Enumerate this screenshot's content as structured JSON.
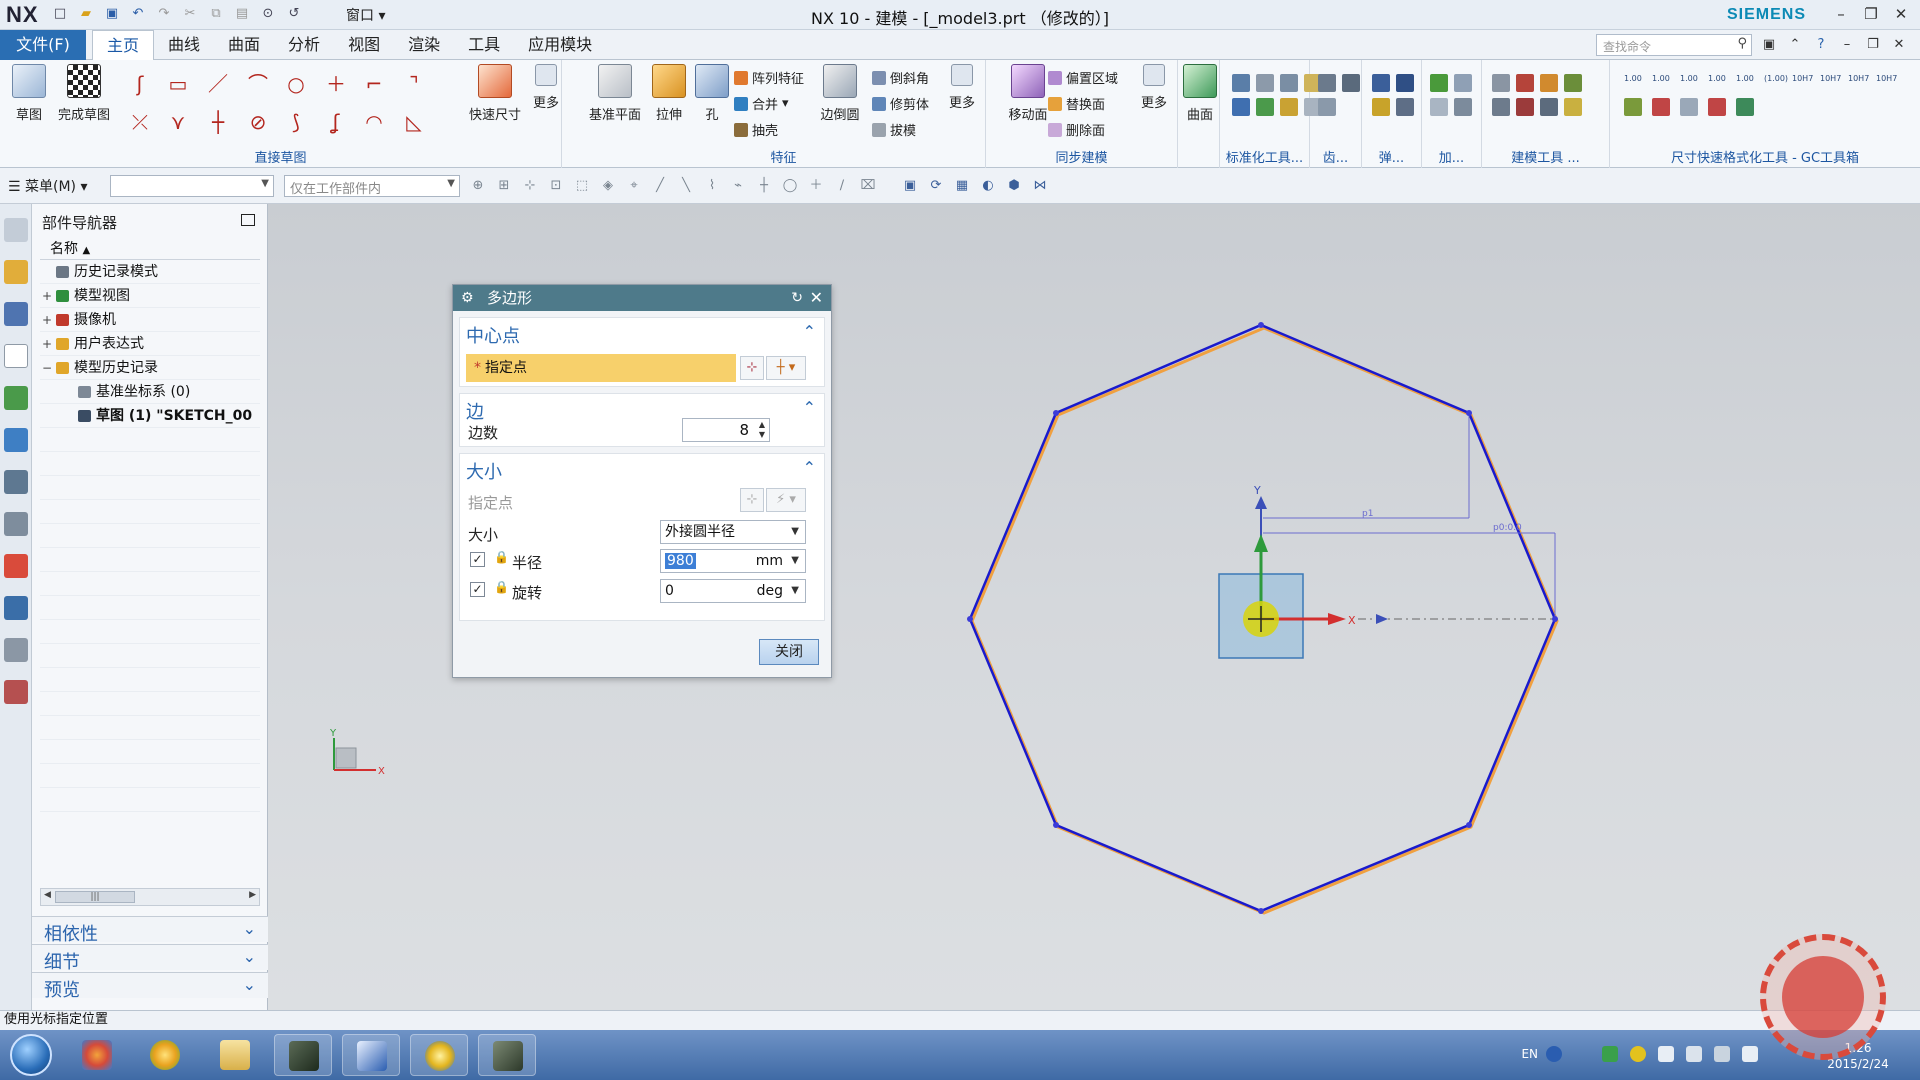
{
  "app": {
    "logo": "NX",
    "title": "NX 10 - 建模 - [_model3.prt （修改的）]",
    "brand": "SIEMENS",
    "window_menu": "窗口"
  },
  "ribbon_tabs": {
    "file": "文件(F)",
    "tabs": [
      "主页",
      "曲线",
      "曲面",
      "分析",
      "视图",
      "渲染",
      "工具",
      "应用模块"
    ],
    "search_placeholder": "查找命令"
  },
  "ribbon": {
    "sketch": "草图",
    "finish_sketch": "完成草图",
    "group_direct_sketch": "直接草图",
    "quick_dimension": "快速尺寸",
    "more": "更多",
    "datum_plane": "基准平面",
    "extrude": "拉伸",
    "hole": "孔",
    "pattern_feature": "阵列特征",
    "unite": "合并",
    "shell": "抽壳",
    "edge_blend": "边倒圆",
    "chamfer": "倒斜角",
    "trim_body": "修剪体",
    "draft": "拔模",
    "group_feature": "特征",
    "move_face": "移动面",
    "offset_region": "偏置区域",
    "replace_face": "替换面",
    "delete_face": "删除面",
    "group_sync": "同步建模",
    "surface": "曲面",
    "group_std_tools": "标准化工具...",
    "group_gear": "齿...",
    "group_spring": "弹...",
    "group_add": "加...",
    "group_modeling_tools": "建模工具 ...",
    "group_dim_tools": "尺寸快速格式化工具 - GC工具箱",
    "dim_labels": [
      "1.00",
      "1.00",
      "1.00",
      "1.00",
      "1.00",
      "(1.00)",
      "10H7",
      "10H7",
      "10H7",
      "10H7"
    ]
  },
  "selection_bar": {
    "menu": "菜单(M)",
    "filter_value": "",
    "scope": "仅在工作部件内"
  },
  "navigator": {
    "title": "部件导航器",
    "column": "名称",
    "items": [
      {
        "label": "历史记录模式",
        "level": 1,
        "pm": "",
        "icon_color": "#6b7785"
      },
      {
        "label": "模型视图",
        "level": 1,
        "pm": "+",
        "icon_color": "#2f8f3e"
      },
      {
        "label": "摄像机",
        "level": 1,
        "pm": "+",
        "icon_color": "#c0392b"
      },
      {
        "label": "用户表达式",
        "level": 1,
        "pm": "+",
        "icon_color": "#e0a62a"
      },
      {
        "label": "模型历史记录",
        "level": 1,
        "pm": "−",
        "icon_color": "#e0a62a"
      },
      {
        "label": "基准坐标系 (0)",
        "level": 2,
        "pm": "",
        "icon_color": "#7d8896"
      },
      {
        "label": "草图 (1) \"SKETCH_00",
        "level": 2,
        "pm": "",
        "icon_color": "#3a4c63"
      }
    ],
    "panels": [
      "相依性",
      "细节",
      "预览"
    ]
  },
  "dialog": {
    "title": "多边形",
    "section_center": "中心点",
    "specify_point": "指定点",
    "section_edges": "边",
    "edge_count_label": "边数",
    "edge_count": "8",
    "section_size": "大小",
    "size_specify_point": "指定点",
    "size_label": "大小",
    "size_mode": "外接圆半径",
    "radius_label": "半径",
    "radius_value": "980",
    "radius_unit": "mm",
    "rotation_label": "旋转",
    "rotation_value": "0",
    "rotation_unit": "deg",
    "close": "关闭"
  },
  "canvas": {
    "axis_y": "Y",
    "axis_x": "X",
    "dim_label_1": "p1",
    "dim_label_2": "p0:0.0",
    "triad_y": "Y",
    "triad_x": "X",
    "polygon_color": "#1a1acc",
    "preview_color": "#f0a040"
  },
  "status": {
    "text": "使用光标指定位置"
  },
  "taskbar": {
    "lang": "EN",
    "time": "1:26",
    "date": "2015/2/24"
  }
}
